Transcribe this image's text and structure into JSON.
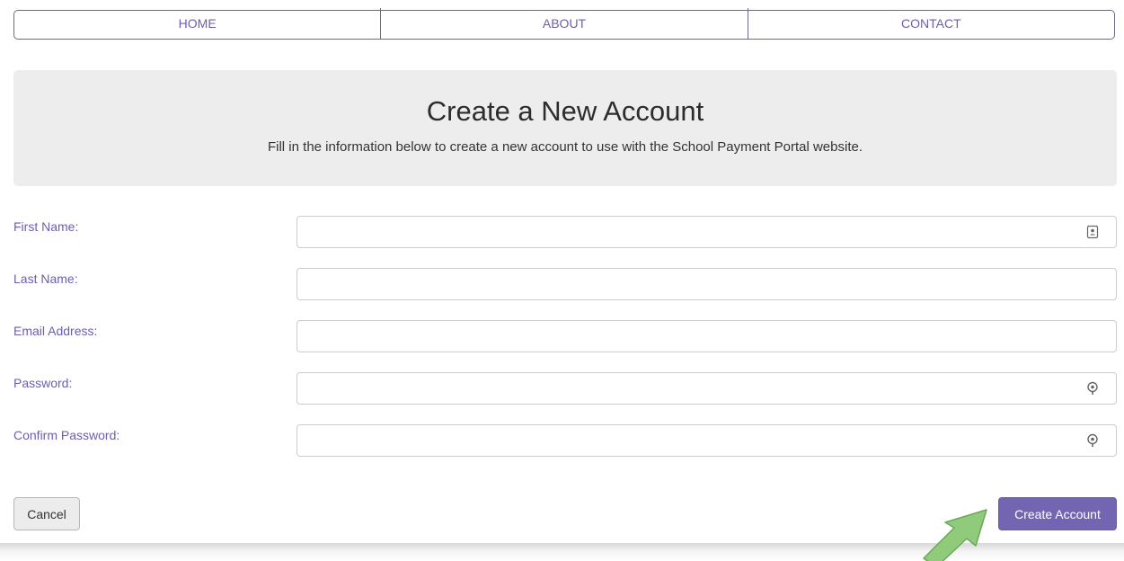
{
  "nav": {
    "items": [
      {
        "label": "HOME"
      },
      {
        "label": "ABOUT"
      },
      {
        "label": "CONTACT"
      }
    ]
  },
  "hero": {
    "title": "Create a New Account",
    "subtitle": "Fill in the information below to create a new account to use with the School Payment Portal website."
  },
  "form": {
    "first_name": {
      "label": "First Name:",
      "value": "",
      "icon": "contact-card-icon"
    },
    "last_name": {
      "label": "Last Name:",
      "value": ""
    },
    "email": {
      "label": "Email Address:",
      "value": ""
    },
    "password": {
      "label": "Password:",
      "value": "",
      "icon": "password-key-icon"
    },
    "confirm_password": {
      "label": "Confirm Password:",
      "value": "",
      "icon": "password-key-icon"
    }
  },
  "actions": {
    "cancel_label": "Cancel",
    "create_label": "Create Account"
  },
  "colors": {
    "accent": "#7465b2",
    "link": "#6b5fae",
    "hero_bg": "#ededed",
    "arrow": "#8fcb7a"
  }
}
